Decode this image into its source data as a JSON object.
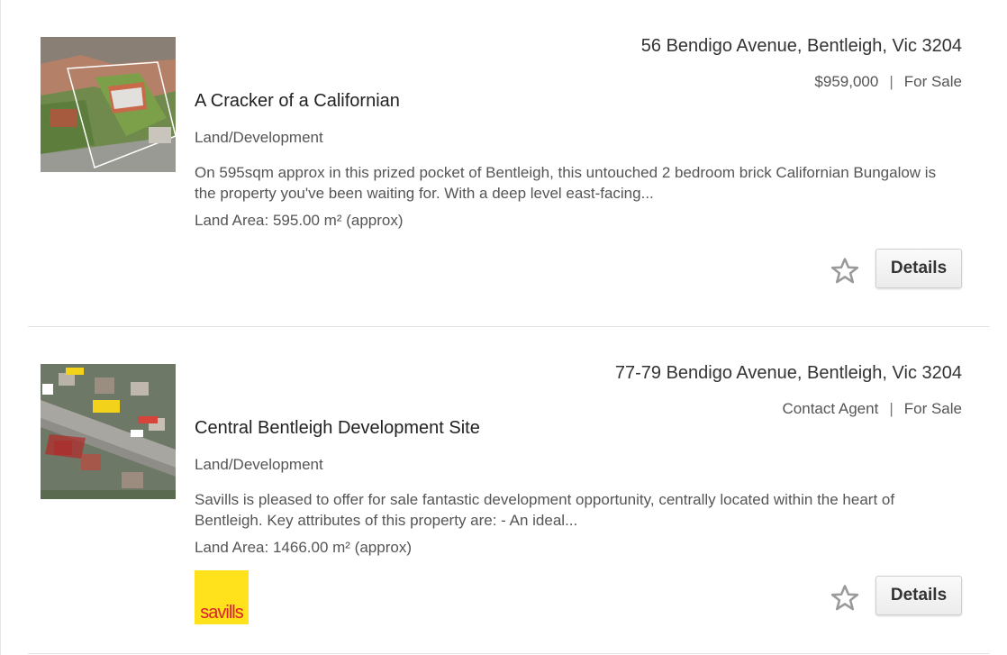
{
  "listings": [
    {
      "address": "56 Bendigo Avenue, Bentleigh, Vic 3204",
      "price": "$959,000",
      "status": "For Sale",
      "separator": "|",
      "title": "A Cracker of a Californian",
      "category": "Land/Development",
      "description": "On 595sqm approx in this prized pocket of Bentleigh, this untouched 2 bedroom brick Californian Bungalow is the property you've been waiting for. With a deep level east-facing...",
      "land_area": "Land Area: 595.00 m² (approx)",
      "details_label": "Details",
      "thumbnail_icon": "aerial-house-photo"
    },
    {
      "address": "77-79 Bendigo Avenue, Bentleigh, Vic 3204",
      "price": "Contact Agent",
      "status": "For Sale",
      "separator": "|",
      "title": "Central Bentleigh Development Site",
      "category": "Land/Development",
      "description": "Savills is pleased to offer for sale fantastic development opportunity, centrally located within the heart of Bentleigh. Key attributes of this property are: - An ideal...",
      "land_area": "Land Area: 1466.00 m² (approx)",
      "details_label": "Details",
      "thumbnail_icon": "aerial-map-photo",
      "agency_logo": "savills",
      "agency_logo_color": "#ffe11c"
    }
  ],
  "colors": {
    "star": "#9a9a9a",
    "button_bg": "#f2f2f2"
  }
}
